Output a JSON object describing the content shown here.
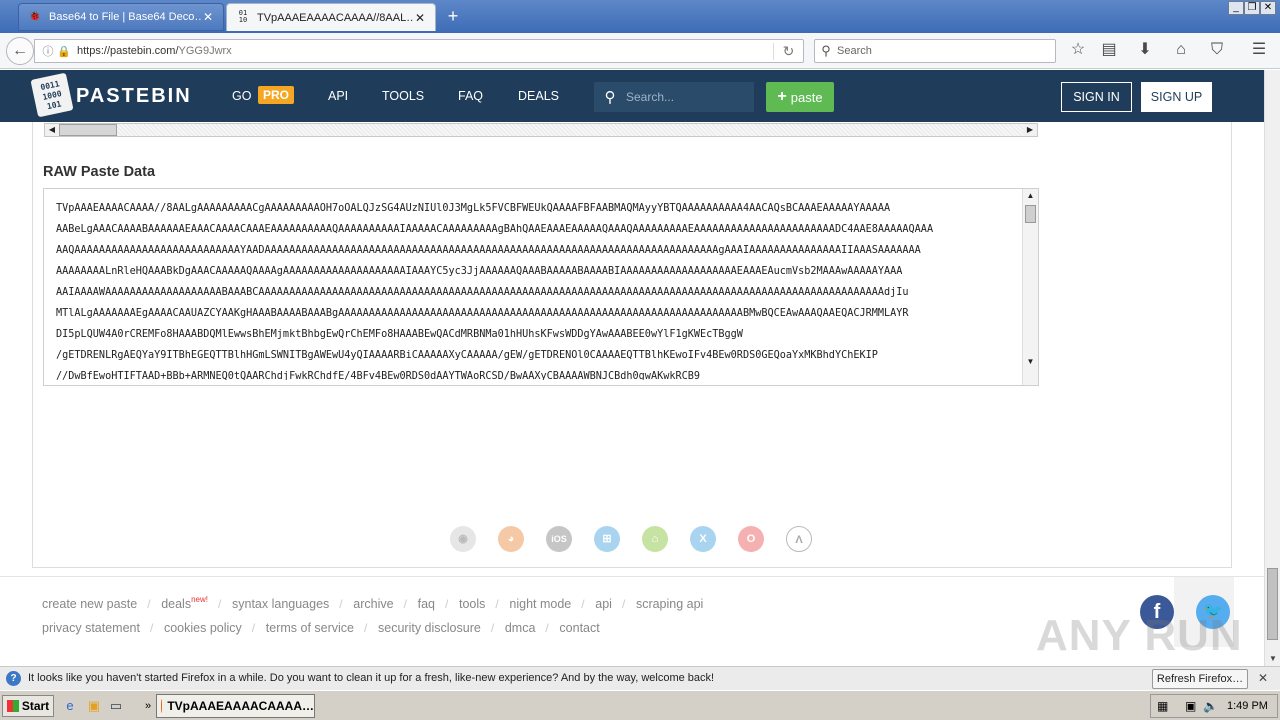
{
  "browser": {
    "tabs": [
      {
        "title": "Base64 to File | Base64 Deco…",
        "favicon": "bug-icon"
      },
      {
        "title": "TVpAAAEAAAACAAAA//8AAL…",
        "favicon": "pastebin-icon"
      }
    ],
    "url_host": "https://pastebin.com/",
    "url_path": "YGG9Jwrx",
    "search_placeholder": "Search"
  },
  "site": {
    "logo": "PASTEBIN",
    "logo_mark": "0011\n1000\n101",
    "nav": {
      "go": "GO",
      "pro": "PRO",
      "api": "API",
      "tools": "TOOLS",
      "faq": "FAQ",
      "deals": "DEALS"
    },
    "search_placeholder": "Search...",
    "paste_button": "paste",
    "sign_in": "SIGN IN",
    "sign_up": "SIGN UP"
  },
  "paste": {
    "raw_title": "RAW Paste Data",
    "raw_lines": [
      "TVpAAAEAAAACAAAA//8AALgAAAAAAAAACgAAAAAAAAAOH7oOALQJzSG4AUzNIUl0J3MgLk5FVCBFWEUkQAAAAFBFAABMAQMAyyYBTQAAAAAAAAAA4AACAQsBCAAAEAAAAAYAAAAA",
      "AABeLgAAACAAAABAAAAAAEAAACAAAACAAAEAAAAAAAAAAQAAAAAAAAAAIAAAAACAAAAAAAAAgBAhQAAEAAAEAAAAAQAAAQAAAAAAAAAEAAAAAAAAAAAAAAAAAAAAAAADC4AAE8AAAAAQAAA",
      "AAQAAAAAAAAAAAAAAAAAAAAAAAAAAAYAADAAAAAAAAAAAAAAAAAAAAAAAAAAAAAAAAAAAAAAAAAAAAAAAAAAAAAAAAAAAAAAAAAAAAAAAAAAgAAAIAAAAAAAAAAAAAAAIIAAASAAAAAAA",
      "AAAAAAAALnRleHQAAABkDgAAACAAAAAQAAAAgAAAAAAAAAAAAAAAAAAAAIAAAYC5yc3JjAAAAAAQAAABAAAAABAAAABIAAAAAAAAAAAAAAAAAAAEAAAEAucmVsb2MAAAwAAAAAYAAA",
      "AAIAAAAWAAAAAAAAAAAAAAAAAAABAAABCAAAAAAAAAAAAAAAAAAAAAAAAAAAAAAAAAAAAAAAAAAAAAAAAAAAAAAAAAAAAAAAAAAAAAAAAAAAAAAAAAAAAAAAAAAAAAAAAAAAAAAdjIu",
      "MTlALgAAAAAAAEgAAAACAAUAZCYAAKgHAAABAAAABAAABgAAAAAAAAAAAAAAAAAAAAAAAAAAAAAAAAAAAAAAAAAAAAAAAAAAAAAAAAAAAAAAAAAABMwBQCEAwAAAQAAEQACJRMMLAYR",
      "DI5pLQUW4A0rCREMFo8HAAABDQMlEwwsBhEMjmktBhbgEwQrChEMFo8HAAABEwQACdMRBNMa01hHUhsKFwsWDDgYAwAAABEE0wYlF1gKWEcTBggW",
      "/gETDRENLRgAEQYaY9ITBhEGEQTTBlhHGmLSWNITBgAWEwU4yQIAAAARBiCAAAAAXyCAAAAA/gEW/gETDRENOl0CAAAAEQTTBlhKEwoIFv4BEw0RDS0GEQoaYxMKBhdYChEKIP",
      "//DwBfEwoHTIFTAAD+BBb+ARMNEQ0tQAARChdjFwkRChdfE/4BFv4BEw0RDS0dAAYTWAoRCSD/BwAAXyCBAAAAWBNJCBdh0gwAKwkRCB9"
    ]
  },
  "platform_icons": [
    "chrome-icon",
    "firefox-icon",
    "ios-icon",
    "windows-icon",
    "android-icon",
    "mac-icon",
    "opera-icon",
    "linux-icon"
  ],
  "footer": {
    "row1": [
      "create new paste",
      "deals",
      "syntax languages",
      "archive",
      "faq",
      "tools",
      "night mode",
      "api",
      "scraping api"
    ],
    "new_badge": "new!",
    "row2": [
      "privacy statement",
      "cookies policy",
      "terms of service",
      "security disclosure",
      "dmca",
      "contact"
    ],
    "watermark": "ANY RUN"
  },
  "notification": {
    "message": "It looks like you haven't started Firefox in a while. Do you want to clean it up for a fresh, like-new experience? And by the way, welcome back!",
    "button": "Refresh Firefox…"
  },
  "taskbar": {
    "start": "Start",
    "task_title": "TVpAAAEAAAACAAAA…",
    "clock": "1:49 PM"
  },
  "colors": {
    "header": "#1f3d5a",
    "pro": "#f5a623",
    "paste": "#5fba53",
    "facebook": "#3b5998",
    "twitter": "#55acee"
  }
}
